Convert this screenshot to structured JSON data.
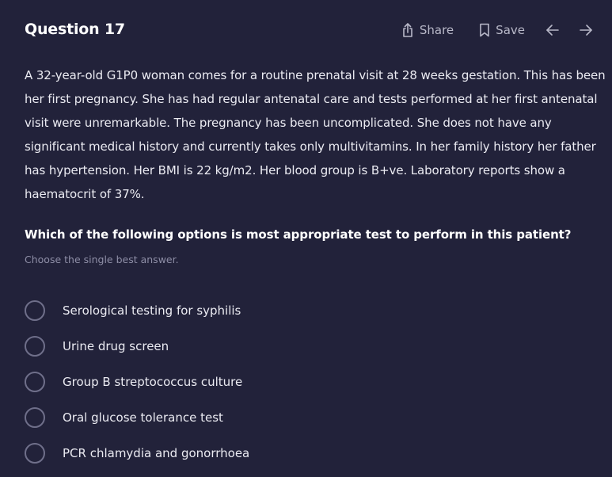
{
  "header": {
    "title": "Question 17",
    "share_label": "Share",
    "save_label": "Save",
    "prev_icon": "arrow-left-icon",
    "next_icon": "arrow-right-icon"
  },
  "question": {
    "stem": "A 32-year-old G1P0 woman comes for a routine prenatal visit at 28 weeks gestation. This has been her first pregnancy. She has had regular antenatal care and tests performed at her first antenatal visit were unremarkable. The pregnancy has been uncomplicated. She does not have any significant medical history and currently takes only multivitamins. In her family history her father has hypertension. Her BMI is 22 kg/m2. Her blood group is B+ve. Laboratory reports show a haematocrit of 37%.",
    "prompt": "Which of the following options is most appropriate test to perform in this patient?",
    "hint": "Choose the single best answer."
  },
  "options": [
    {
      "label": "Serological testing for syphilis"
    },
    {
      "label": "Urine drug screen"
    },
    {
      "label": "Group B streptococcus culture"
    },
    {
      "label": "Oral glucose tolerance test"
    },
    {
      "label": "PCR chlamydia and gonorrhoea"
    }
  ],
  "colors": {
    "background": "#22223a",
    "text": "#ebebf2",
    "muted": "#8e8ea6",
    "radio_border": "#6f6f8a"
  }
}
